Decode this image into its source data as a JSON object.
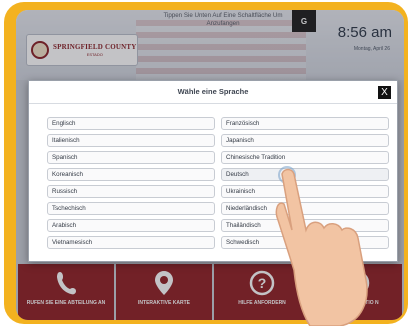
{
  "header": {
    "county_name": "SPRINGFIELD COUNTY",
    "county_sub": "ESTADO",
    "translate_hint": "Tippen Sie Unten Auf Eine Schaltfläche Um Anzufangen",
    "translate_icon_label": "G",
    "time": "8:56 am",
    "date": "Montag, April 26"
  },
  "dialog": {
    "title": "Wähle eine Sprache",
    "close_label": "X",
    "languages": [
      "Englisch",
      "Französisch",
      "Italienisch",
      "Japanisch",
      "Spanisch",
      "Chinesische Tradition",
      "Koreanisch",
      "Deutsch",
      "Russisch",
      "Ukrainisch",
      "Tschechisch",
      "Niederländisch",
      "Arabisch",
      "Thailändisch",
      "Vietnamesisch",
      "Schwedisch"
    ],
    "selected": "Deutsch"
  },
  "tiles": [
    {
      "label": "RUFEN SIE EINE ABTEILUNG AN",
      "icon": "phone-icon"
    },
    {
      "label": "INTERAKTIVE KARTE",
      "icon": "map-pin-icon"
    },
    {
      "label": "HILFE ANFORDERN",
      "icon": "help-icon"
    },
    {
      "label": "ERINFORMATIO N",
      "icon": "info-icon"
    }
  ],
  "colors": {
    "frame": "#f3b21f",
    "tile": "#8f1f23",
    "title_text": "#8a1f25"
  }
}
